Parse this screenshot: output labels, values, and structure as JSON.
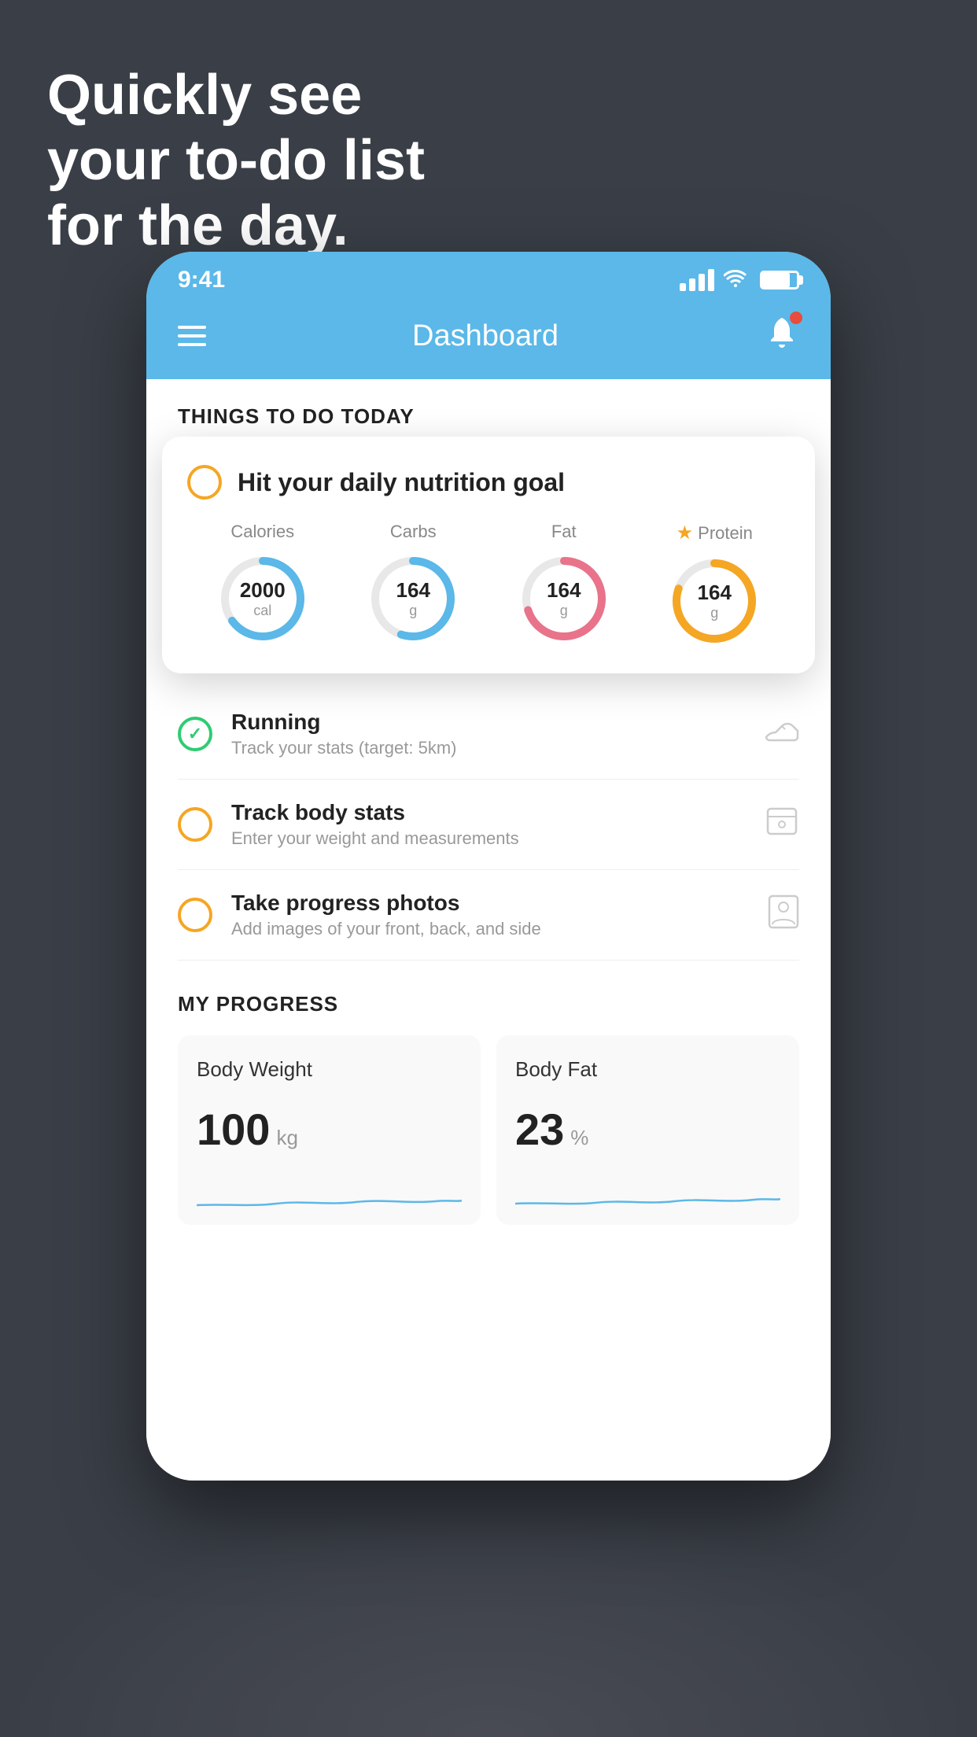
{
  "headline": {
    "line1": "Quickly see",
    "line2": "your to-do list",
    "line3": "for the day."
  },
  "statusBar": {
    "time": "9:41"
  },
  "header": {
    "title": "Dashboard"
  },
  "thingsToDo": {
    "sectionLabel": "THINGS TO DO TODAY"
  },
  "nutritionCard": {
    "circleColor": "#f5a623",
    "title": "Hit your daily nutrition goal",
    "items": [
      {
        "label": "Calories",
        "value": "2000",
        "unit": "cal",
        "color": "#5bb8e8",
        "pct": 65
      },
      {
        "label": "Carbs",
        "value": "164",
        "unit": "g",
        "color": "#5bb8e8",
        "pct": 55
      },
      {
        "label": "Fat",
        "value": "164",
        "unit": "g",
        "color": "#e8738a",
        "pct": 70
      },
      {
        "label": "Protein",
        "value": "164",
        "unit": "g",
        "color": "#f5a623",
        "pct": 80,
        "starred": true
      }
    ]
  },
  "todoItems": [
    {
      "title": "Running",
      "subtitle": "Track your stats (target: 5km)",
      "iconColor": "#2ecc71",
      "checked": true,
      "actionIcon": "shoe"
    },
    {
      "title": "Track body stats",
      "subtitle": "Enter your weight and measurements",
      "iconColor": "#f5a623",
      "checked": false,
      "actionIcon": "scale"
    },
    {
      "title": "Take progress photos",
      "subtitle": "Add images of your front, back, and side",
      "iconColor": "#f5a623",
      "checked": false,
      "actionIcon": "person"
    }
  ],
  "myProgress": {
    "sectionLabel": "MY PROGRESS",
    "cards": [
      {
        "label": "Body Weight",
        "value": "100",
        "unit": "kg",
        "sparkColor": "#5bb8e8"
      },
      {
        "label": "Body Fat",
        "value": "23",
        "unit": "%",
        "sparkColor": "#5bb8e8"
      }
    ]
  }
}
